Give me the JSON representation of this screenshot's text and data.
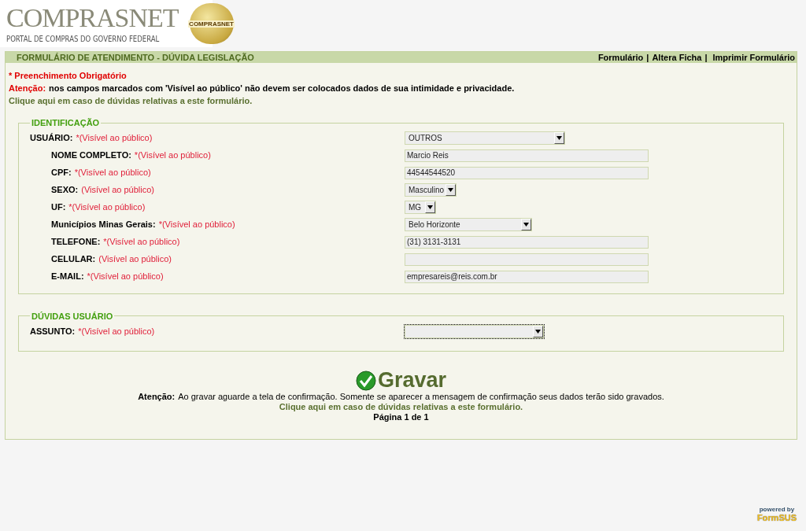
{
  "logo": {
    "title": "COMPRASNET",
    "subtitle": "PORTAL DE COMPRAS DO GOVERNO FEDERAL",
    "emblem": "COMPRASNET"
  },
  "form_header": {
    "title": "FORMULÁRIO DE ATENDIMENTO - DÚVIDA LEGISLAÇÃO",
    "links": [
      "Formulário",
      "Altera Ficha",
      "Imprimir Formulário"
    ],
    "separators": [
      "|",
      "|"
    ]
  },
  "notice": {
    "required": "* Preenchimento Obrigatório",
    "warning_label": "Atenção:",
    "warning_text": "nos campos marcados com 'Visível ao público' não devem ser colocados dados de sua intimidade e privacidade.",
    "help_link": "Clique aqui em caso de dúvidas relativas a este formulário."
  },
  "sections": [
    {
      "legend": "IDENTIFICAÇÃO",
      "fields": [
        {
          "label": "USUÁRIO:",
          "note": "*(Visível ao público)",
          "kind": "select",
          "value": "OUTROS",
          "children": [
            {
              "label": "NOME COMPLETO:",
              "note": "*(Visível ao público)",
              "kind": "text",
              "value": "Marcio Reis"
            },
            {
              "label": "CPF:",
              "note": "*(Visível ao público)",
              "kind": "text",
              "value": "44544544520"
            },
            {
              "label": "SEXO:",
              "note": "(Visível ao público)",
              "kind": "select",
              "value": "Masculino"
            },
            {
              "label": "UF:",
              "note": "*(Visível ao público)",
              "kind": "select",
              "value": "MG"
            },
            {
              "label": "Municípios Minas Gerais:",
              "note": "*(Visível ao público)",
              "kind": "select",
              "value": "Belo Horizonte"
            },
            {
              "label": "TELEFONE:",
              "note": "*(Visível ao público)",
              "kind": "text",
              "value": "(31) 3131-3131"
            },
            {
              "label": "CELULAR:",
              "note": "(Visível ao público)",
              "kind": "text"
            },
            {
              "label": "E-MAIL:",
              "note": "*(Visível ao público)",
              "kind": "text",
              "value": "empresareis@reis.com.br"
            }
          ]
        }
      ]
    },
    {
      "legend": "DÚVIDAS USUÁRIO",
      "fields": [
        {
          "label": "ASSUNTO:",
          "note": "*(Visível ao público)",
          "kind": "select",
          "focused": true
        }
      ]
    }
  ],
  "save_button": "Gravar",
  "footer": {
    "warning_label": "Atenção:",
    "warning_text": "Ao gravar aguarde a tela de confirmação. Somente se aparecer a mensagem de confirmação seus dados terão sido gravados.",
    "help_link": "Clique aqui em caso de dúvidas relativas a este formulário.",
    "page": "Página 1 de 1"
  },
  "powered_by": {
    "label": "powered by",
    "brand": "FormSUS"
  }
}
